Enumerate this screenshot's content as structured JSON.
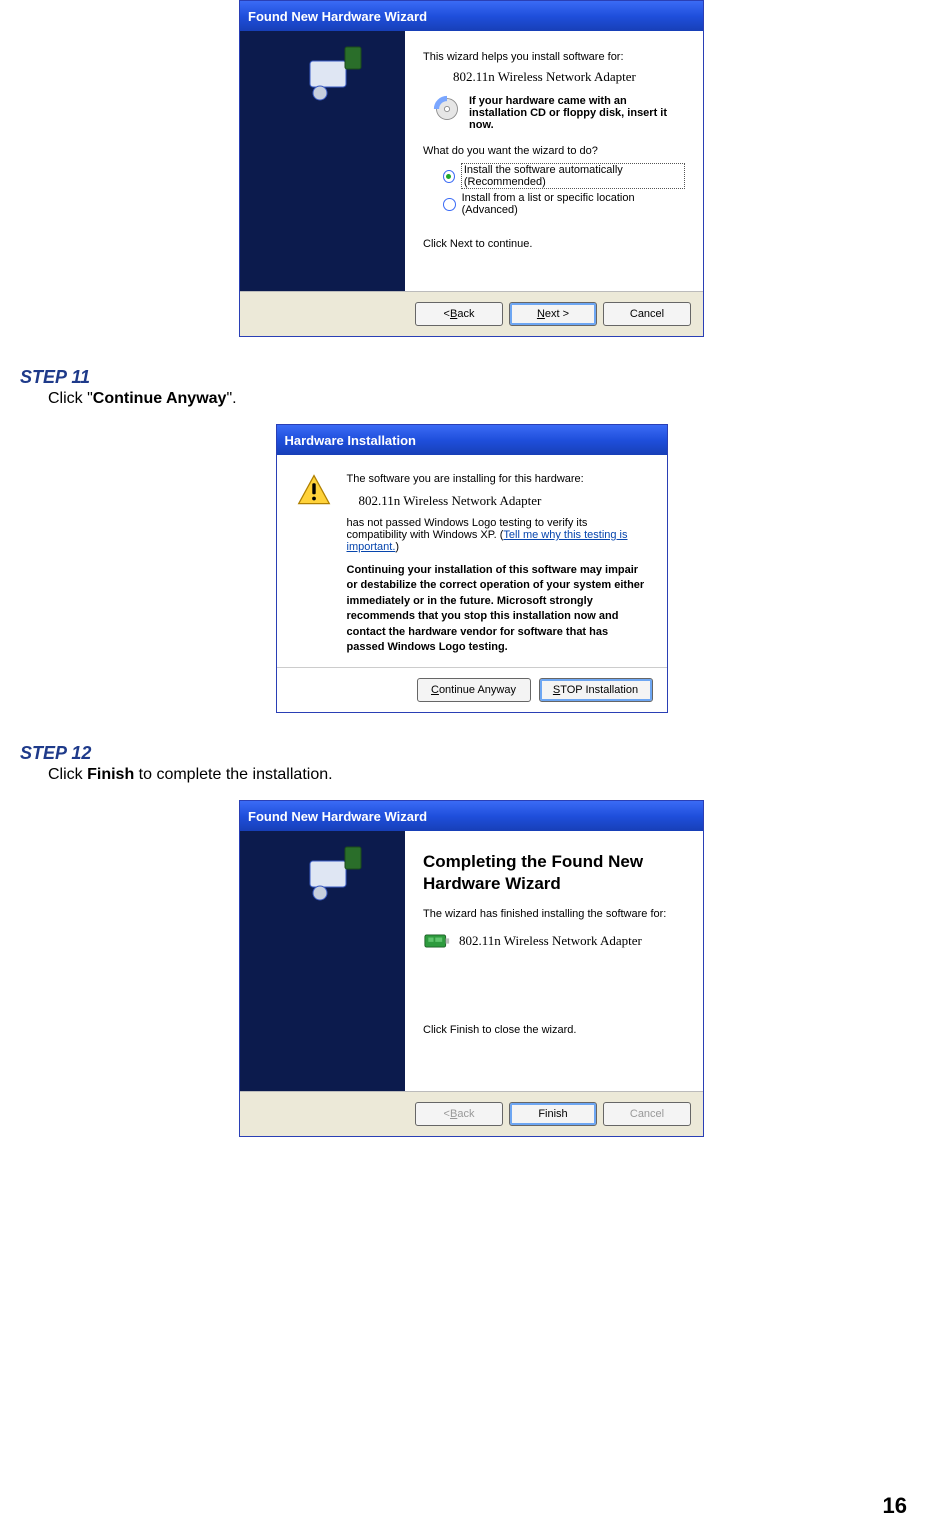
{
  "page_number": "16",
  "step11": {
    "label": "STEP 11",
    "text_pre": "Click \"",
    "text_bold": "Continue Anyway",
    "text_post": "\"."
  },
  "step12": {
    "label": "STEP 12",
    "text_pre": "Click ",
    "text_bold": "Finish",
    "text_post": " to complete the installation."
  },
  "dialog1": {
    "title": "Found New Hardware Wizard",
    "l1": "This wizard helps you install software for:",
    "device": "802.11n Wireless Network Adapter",
    "cd_text": "If your hardware came with an installation CD or floppy disk, insert it now.",
    "l2": "What do you want the wizard to do?",
    "opt1": "Install the software automatically (Recommended)",
    "opt2": "Install from a list or specific location (Advanced)",
    "l3": "Click Next to continue.",
    "btn_back_lt": "< ",
    "btn_back_u": "B",
    "btn_back_rest": "ack",
    "btn_next_u": "N",
    "btn_next_rest": "ext >",
    "btn_cancel": "Cancel"
  },
  "dialog2": {
    "title": "Hardware Installation",
    "l1": "The software you are installing for this hardware:",
    "device": "802.11n Wireless Network Adapter",
    "l2a": "has not passed Windows Logo testing to verify its compatibility with Windows XP. (",
    "link": "Tell me why this testing is important.",
    "l2b": ")",
    "bold": "Continuing your installation of this software may impair or destabilize the correct operation of your system either immediately or in the future. Microsoft strongly recommends that you stop this installation now and contact the hardware vendor for software that has passed Windows Logo testing.",
    "btn_cont_u": "C",
    "btn_cont_rest": "ontinue Anyway",
    "btn_stop_u": "S",
    "btn_stop_rest": "TOP Installation"
  },
  "dialog3": {
    "title": "Found New Hardware Wizard",
    "heading": "Completing the Found New Hardware Wizard",
    "l1": "The wizard has finished installing the software for:",
    "device": "802.11n Wireless Network Adapter",
    "l2": "Click Finish to close the wizard.",
    "btn_back_lt": "< ",
    "btn_back_u": "B",
    "btn_back_rest": "ack",
    "btn_finish": "Finish",
    "btn_cancel": "Cancel"
  }
}
